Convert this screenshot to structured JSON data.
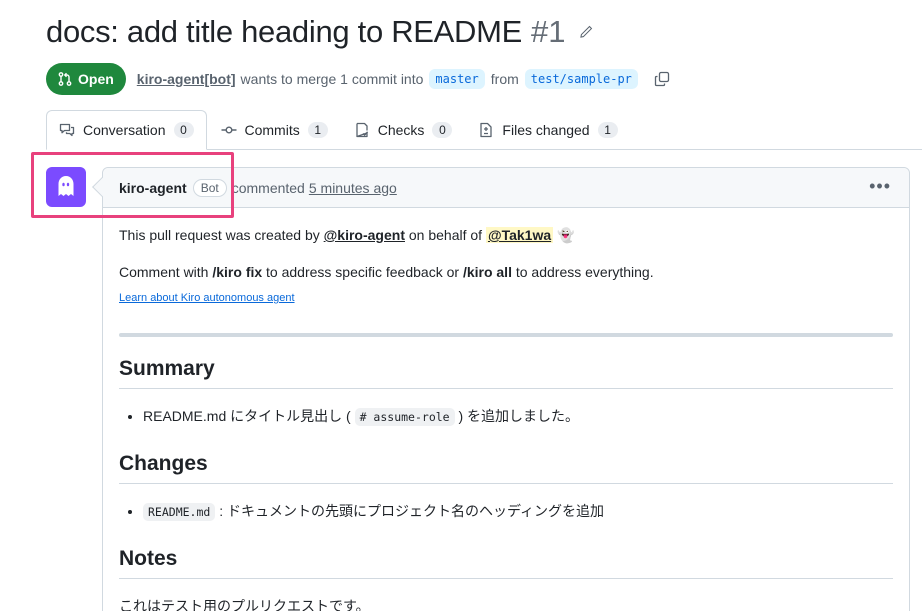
{
  "pr": {
    "title": "docs: add title heading to README",
    "number": "#1",
    "state": "Open",
    "author": "kiro-agent[bot]",
    "merge_text": "wants to merge 1 commit into",
    "base_branch": "master",
    "from_text": "from",
    "head_branch": "test/sample-pr"
  },
  "tabs": [
    {
      "label": "Conversation",
      "count": "0",
      "icon": "comment-discussion-icon"
    },
    {
      "label": "Commits",
      "count": "1",
      "icon": "git-commit-icon"
    },
    {
      "label": "Checks",
      "count": "0",
      "icon": "checklist-icon"
    },
    {
      "label": "Files changed",
      "count": "1",
      "icon": "file-diff-icon"
    }
  ],
  "comment": {
    "author": "kiro-agent",
    "badge": "Bot",
    "action": "commented",
    "time": "5 minutes ago",
    "intro_prefix": "This pull request was created by",
    "intro_mention": "@kiro-agent",
    "intro_middle": "on behalf of",
    "intro_user": "@Tak1wa",
    "intro_emoji": "👻",
    "instructions_prefix": "Comment with",
    "instructions_cmd1": "/kiro fix",
    "instructions_middle": "to address specific feedback or",
    "instructions_cmd2": "/kiro all",
    "instructions_suffix": "to address everything.",
    "learn_link": "Learn about Kiro autonomous agent",
    "summary_heading": "Summary",
    "summary_item_prefix": "README.md にタイトル見出し (",
    "summary_item_code": "# assume-role",
    "summary_item_suffix": ") を追加しました。",
    "changes_heading": "Changes",
    "changes_item_code": "README.md",
    "changes_item_suffix": ": ドキュメントの先頭にプロジェクト名のヘッディングを追加",
    "notes_heading": "Notes",
    "notes_text": "これはテスト用のプルリクエストです。"
  },
  "colors": {
    "open_green": "#1f883d",
    "link_blue": "#0969da",
    "highlight": "#e8417d",
    "avatar": "#7b4bff"
  }
}
